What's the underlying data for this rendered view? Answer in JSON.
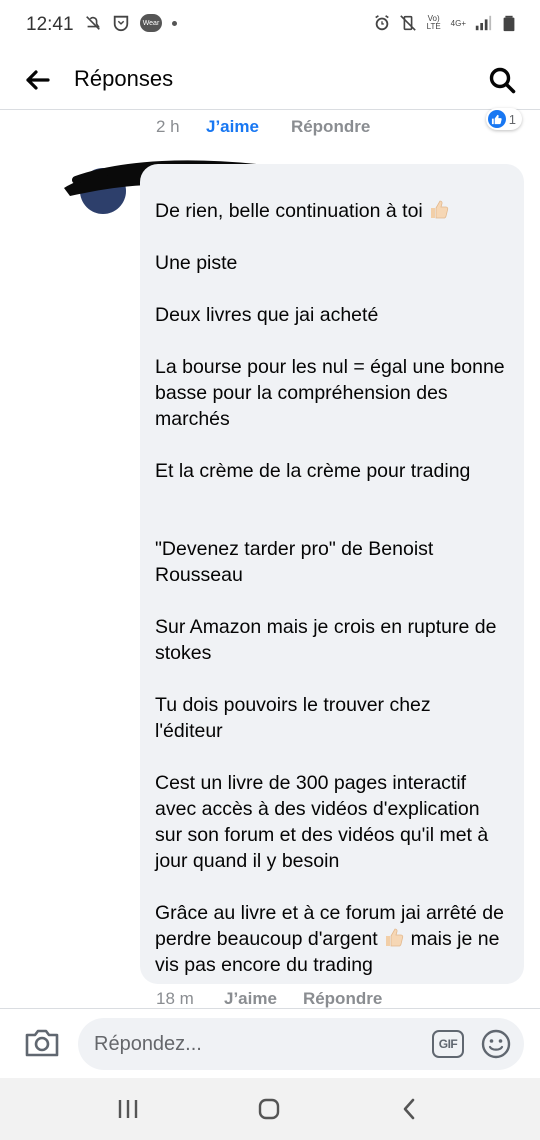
{
  "status_bar": {
    "time": "12:41",
    "left_icons": [
      "notifications-off-icon",
      "vpn-shield-icon",
      "wear-icon",
      "dot-icon"
    ],
    "wear_label": "Wear",
    "right_icons": [
      "alarm-icon",
      "vibrate-mute-icon",
      "volte-icon",
      "4g-icon",
      "signal-icon",
      "battery-icon"
    ],
    "volte_label": "Vo) LTE",
    "network_label": "4G+"
  },
  "header": {
    "title": "Réponses",
    "back_icon": "arrow-left-icon",
    "search_icon": "search-icon"
  },
  "top_comment": {
    "time": "2 h",
    "like_label": "J’aime",
    "reply_label": "Répondre",
    "reaction_count": "1",
    "reaction_icon": "like-reaction-icon"
  },
  "comment": {
    "author_hidden": true,
    "paragraphs": [
      "De rien,  belle continuation à toi",
      "Une piste",
      "Deux livres que jai acheté",
      "La bourse pour les nul = égal une bonne basse pour la compréhension des marchés",
      "Et la crème de la crème pour trading",
      "\"Devenez tarder pro\" de Benoist Rousseau",
      "Sur Amazon mais je crois en rupture de stokes",
      "Tu dois pouvoirs le trouver chez l'éditeur",
      "Cest un livre de 300 pages interactif avec accès à des vidéos d'explication sur son forum et des vidéos qu'il met à jour quand il y besoin",
      "Grâce au livre et à ce forum jai arrêté de perdre beaucoup d'argent",
      "mais je ne vis pas encore du trading"
    ],
    "time": "18 m",
    "like_label": "J’aime",
    "reply_label": "Répondre",
    "bubble_color": "#f0f2f5"
  },
  "composer": {
    "placeholder": "Répondez...",
    "gif_label": "GIF",
    "camera_icon": "camera-icon",
    "emoji_icon": "smiley-icon"
  },
  "nav_bar": {
    "icons": [
      "recent-apps-icon",
      "home-icon",
      "back-chevron-icon"
    ]
  },
  "colors": {
    "accent": "#1877f2",
    "muted_text": "#8a8d91",
    "text": "#050505"
  }
}
